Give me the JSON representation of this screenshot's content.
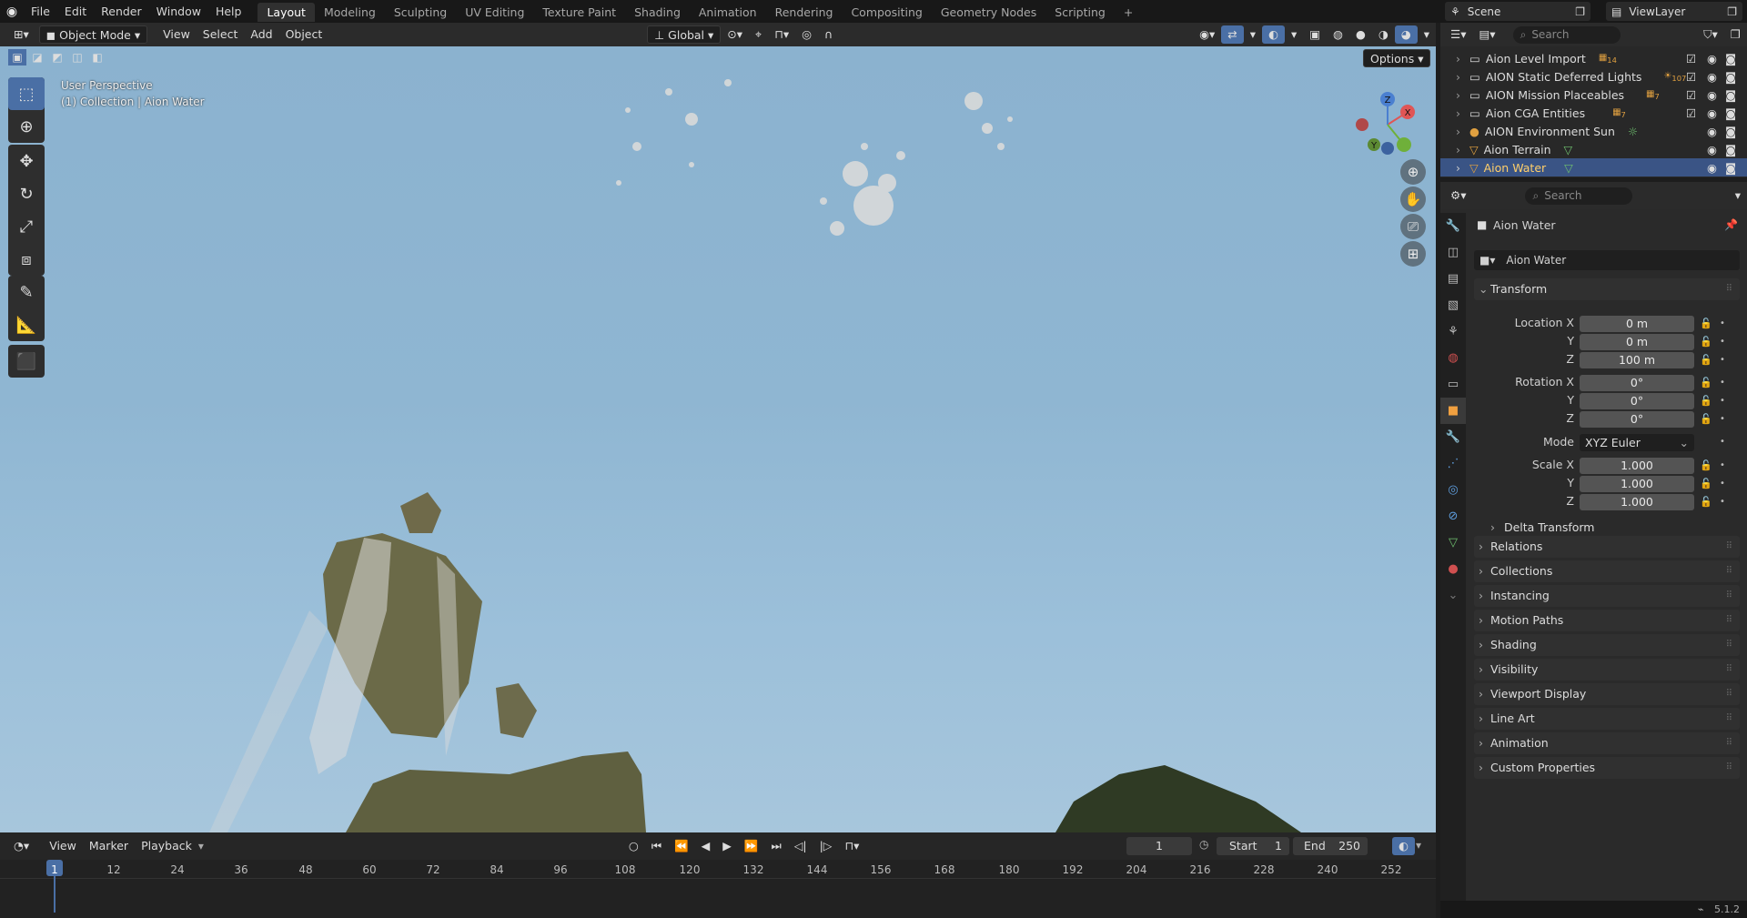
{
  "menu": [
    "File",
    "Edit",
    "Render",
    "Window",
    "Help"
  ],
  "workspaces": [
    "Layout",
    "Modeling",
    "Sculpting",
    "UV Editing",
    "Texture Paint",
    "Shading",
    "Animation",
    "Rendering",
    "Compositing",
    "Geometry Nodes",
    "Scripting"
  ],
  "workspace_add": "+",
  "scene": {
    "name": "Scene",
    "view_layer": "ViewLayer"
  },
  "viewport_header": {
    "mode": "Object Mode",
    "menus": [
      "View",
      "Select",
      "Add",
      "Object"
    ],
    "orientation": "Global",
    "options": "Options"
  },
  "viewport": {
    "perspective": "User Perspective",
    "collection": "(1) Collection | Aion Water"
  },
  "gizmo": {
    "x": "X",
    "y": "Y",
    "z": "Z"
  },
  "outliner": {
    "search_placeholder": "Search",
    "rows": [
      {
        "name": "Aion Level Import",
        "badge": "14"
      },
      {
        "name": "AION Static Deferred Lights",
        "badge": "107"
      },
      {
        "name": "AION Mission Placeables",
        "badge": "7"
      },
      {
        "name": "Aion CGA Entities",
        "badge": "7"
      },
      {
        "name": "AION Environment Sun",
        "badge": ""
      },
      {
        "name": "Aion Terrain",
        "badge": ""
      },
      {
        "name": "Aion Water",
        "badge": ""
      }
    ]
  },
  "properties": {
    "search_placeholder": "Search",
    "object_name": "Aion Water",
    "datablock": "Aion Water",
    "transform_label": "Transform",
    "location_label": "Location X",
    "rotation_label": "Rotation X",
    "scale_label": "Scale X",
    "y_label": "Y",
    "z_label": "Z",
    "location": [
      "0 m",
      "0 m",
      "100 m"
    ],
    "rotation": [
      "0°",
      "0°",
      "0°"
    ],
    "mode_label": "Mode",
    "mode_value": "XYZ Euler",
    "scale": [
      "1.000",
      "1.000",
      "1.000"
    ],
    "delta": "Delta Transform",
    "panels": [
      "Relations",
      "Collections",
      "Instancing",
      "Motion Paths",
      "Shading",
      "Visibility",
      "Viewport Display",
      "Line Art",
      "Animation",
      "Custom Properties"
    ]
  },
  "timeline": {
    "menus": [
      "View",
      "Marker",
      "Playback"
    ],
    "current_frame": "1",
    "start_label": "Start",
    "start": "1",
    "end_label": "End",
    "end": "250",
    "ticks": [
      "1",
      "12",
      "24",
      "36",
      "48",
      "60",
      "72",
      "84",
      "96",
      "108",
      "120",
      "132",
      "144",
      "156",
      "168",
      "180",
      "192",
      "204",
      "216",
      "228",
      "240",
      "252"
    ]
  },
  "status": {
    "version": "5.1.2"
  },
  "colors": {
    "accent": "#4a6fa5",
    "selected_text": "#ffcf6a",
    "sky": "#8fb6d2"
  }
}
